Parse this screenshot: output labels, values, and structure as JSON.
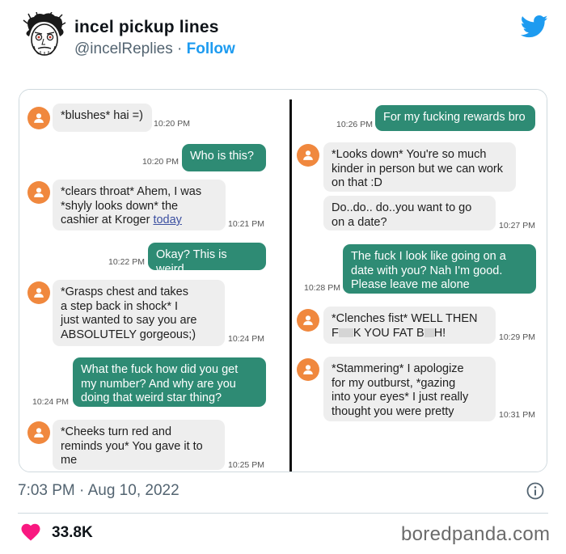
{
  "tweet": {
    "display_name": "incel pickup lines",
    "handle": "@incelReplies",
    "separator": " · ",
    "follow_label": "Follow",
    "timestamp": "7:03 PM · Aug 10, 2022",
    "likes": "33.8K",
    "watermark": "boredpanda.com"
  },
  "icons": {
    "brand": "twitter-bird-icon",
    "info": "info-icon",
    "like": "heart-icon",
    "contact": "person-icon"
  },
  "colors": {
    "twitter_blue": "#1d9bf0",
    "sent_bubble": "#2e8b74",
    "received_bubble": "#eeeeee",
    "contact_avatar": "#f0883e",
    "like_heart": "#f91880"
  },
  "left_thread": [
    {
      "dir": "in",
      "text": "*blushes* hai =)",
      "time": "10:20 PM"
    },
    {
      "dir": "out",
      "text": "Who is this?",
      "time": "10:20 PM"
    },
    {
      "dir": "in",
      "text_parts": [
        "*clears throat* Ahem, I was\n*shyly looks down* the\ncashier at Kroger ",
        "today"
      ],
      "time": "10:21 PM"
    },
    {
      "dir": "out",
      "text": "Okay? This is weird",
      "time": "10:22 PM"
    },
    {
      "dir": "in",
      "text": "*Grasps chest and takes\na step back in shock* I\njust wanted to say you are\nABSOLUTELY gorgeous;)",
      "time": "10:24 PM"
    },
    {
      "dir": "out",
      "text": "What the fuck how did you get\nmy number? And why are you\ndoing that weird star thing?",
      "time": "10:24 PM"
    },
    {
      "dir": "in",
      "text": "*Cheeks turn red and\nreminds you* You gave it to\nme",
      "time": "10:25 PM"
    }
  ],
  "right_thread": [
    {
      "dir": "out",
      "text": "For my fucking rewards bro",
      "time": "10:26 PM"
    },
    {
      "dir": "in",
      "text": "*Looks down* You're so much\nkinder in person but we can work\non that :D",
      "time": ""
    },
    {
      "dir": "in",
      "text": "Do..do.. do..you want to go\non a date?",
      "time": "10:27 PM"
    },
    {
      "dir": "out",
      "text": "The fuck I look like going on a\ndate with you? Nah I'm good.\nPlease leave me alone",
      "time": "10:28 PM"
    },
    {
      "dir": "in",
      "text_parts": [
        "*Clenches fist* WELL THEN\nF",
        "K YOU FAT B",
        "H!"
      ],
      "time": "10:29 PM"
    },
    {
      "dir": "in",
      "text": "*Stammering* I apologize\nfor my outburst, *gazing\ninto your eyes* I just really\nthought you were pretty",
      "time": "10:31 PM"
    }
  ]
}
